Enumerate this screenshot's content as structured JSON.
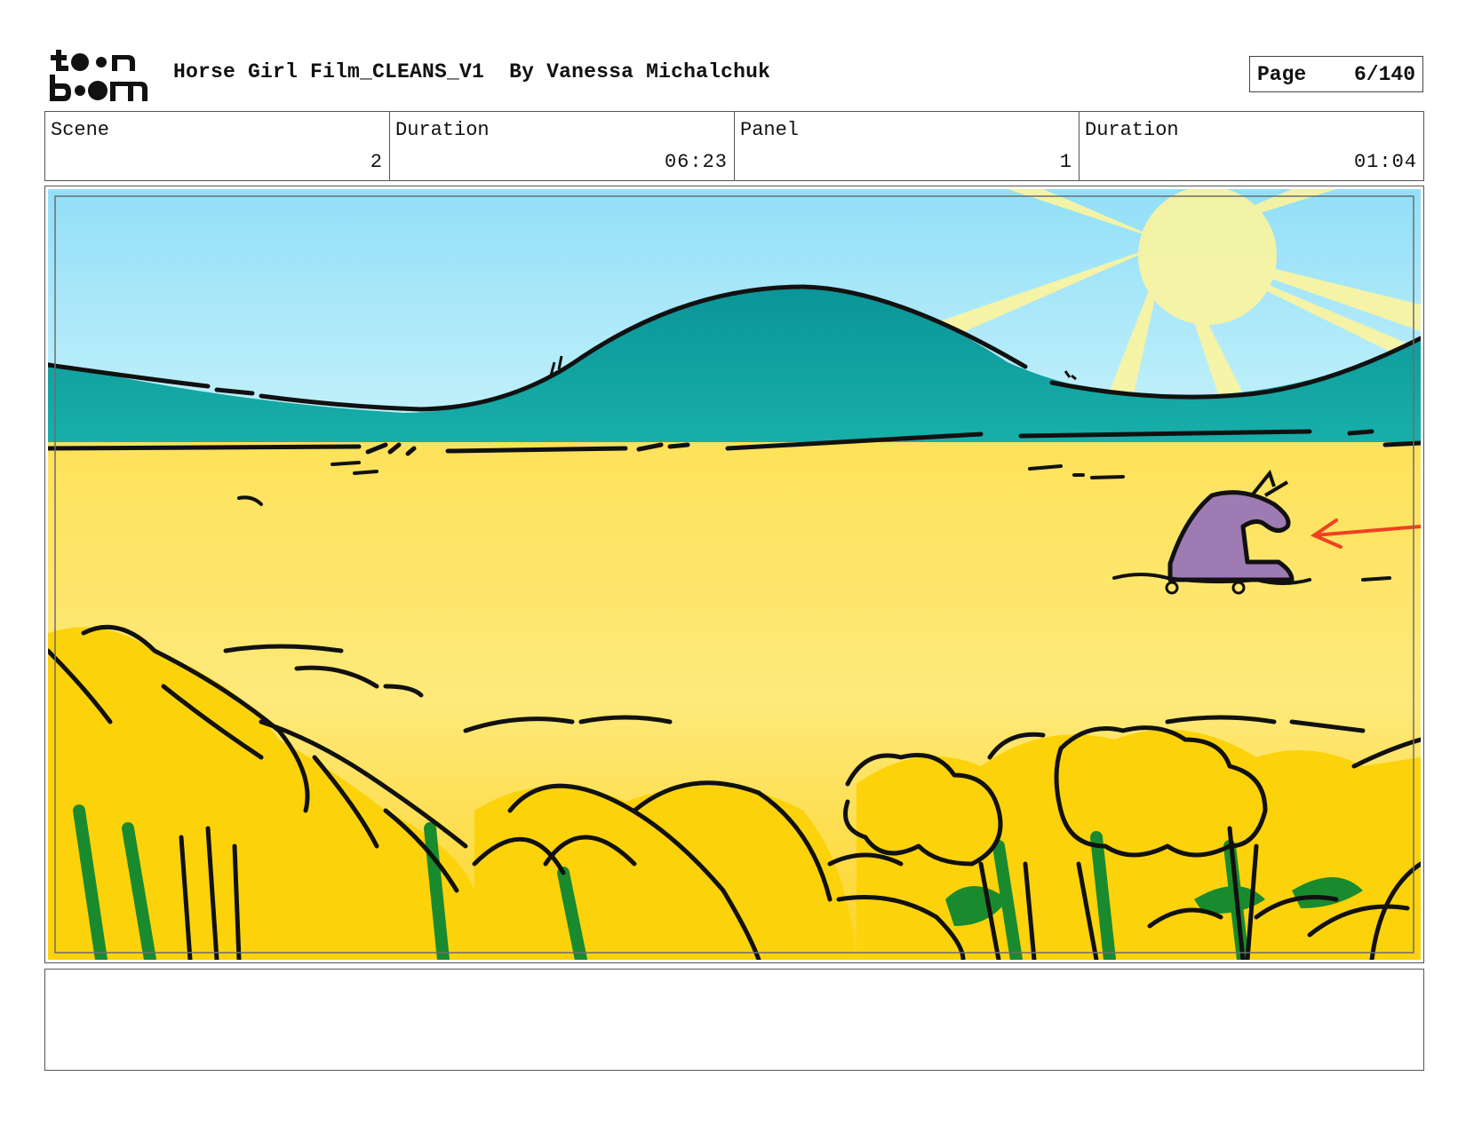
{
  "header": {
    "title": "Horse Girl Film_CLEANS_V1",
    "author": "By Vanessa Michalchuk",
    "page_label": "Page",
    "page_value": "6/140",
    "logo_text": "toon boom"
  },
  "info": {
    "scene_label": "Scene",
    "scene_value": "2",
    "scene_duration_label": "Duration",
    "scene_duration_value": "06:23",
    "panel_label": "Panel",
    "panel_value": "1",
    "panel_duration_label": "Duration",
    "panel_duration_value": "01:04"
  },
  "panel_image": {
    "description_icon": "storyboard-drawing",
    "colors": {
      "sky": "#b8ecfb",
      "hills": "#12a3a0",
      "field": "#fde66a",
      "flowers": "#fcd20a",
      "stems": "#1a8a2e",
      "horse": "#9f7bb3",
      "arrow": "#f0411f",
      "sun": "#fdf5a0"
    }
  },
  "notes": {
    "text": ""
  }
}
